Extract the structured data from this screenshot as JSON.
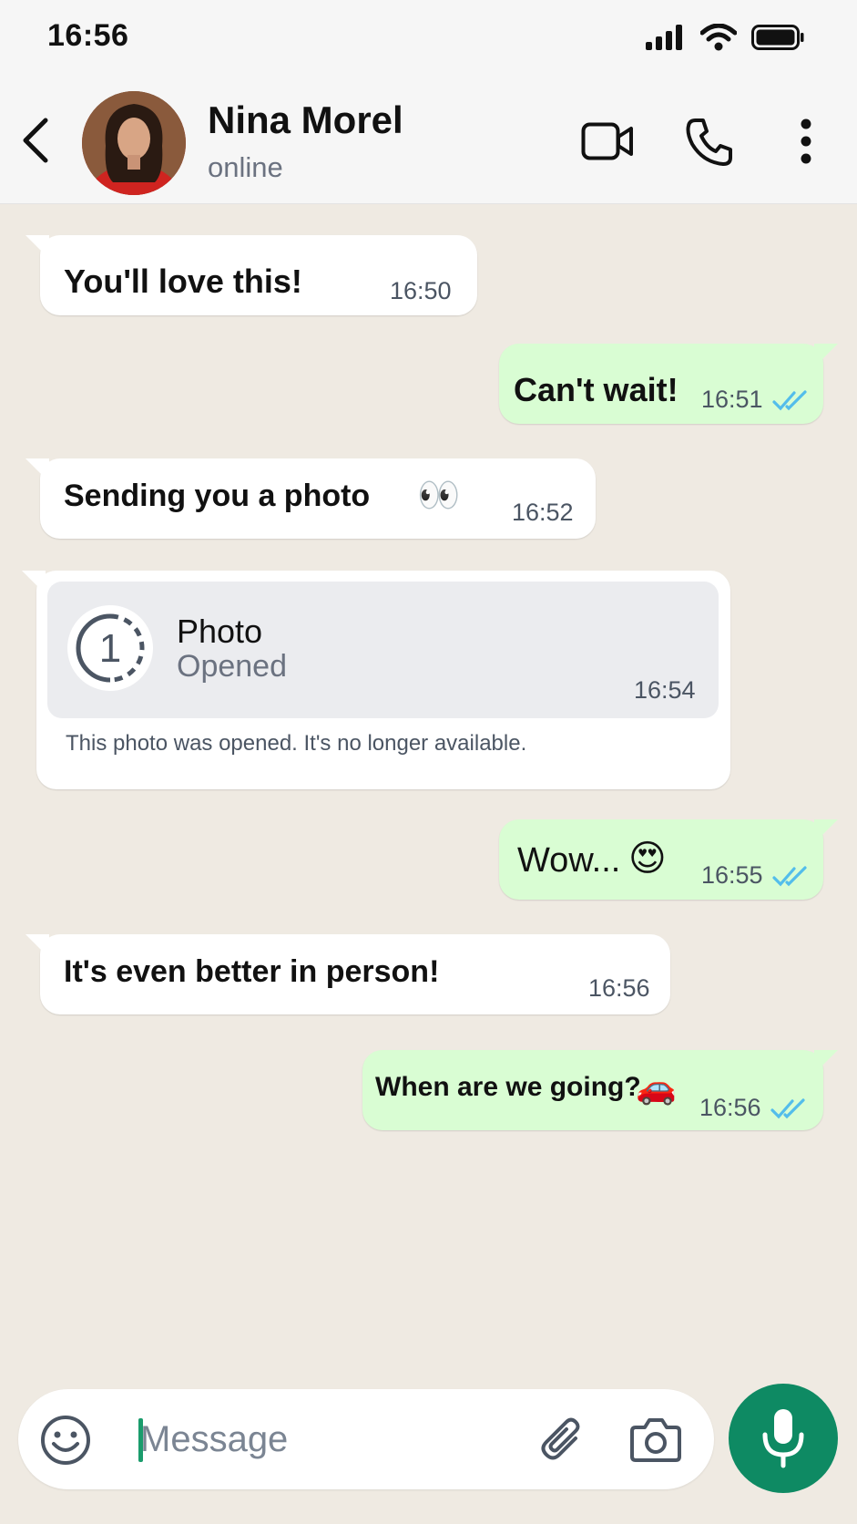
{
  "status_bar": {
    "time": "16:56"
  },
  "contact": {
    "name": "Nina Morel",
    "status": "online"
  },
  "messages": [
    {
      "direction": "in",
      "text": "You'll love this!",
      "time": "16:50"
    },
    {
      "direction": "out",
      "text": "Can't wait!",
      "time": "16:51",
      "read": true
    },
    {
      "direction": "in",
      "text": "Sending you a photo",
      "emoji": "👀",
      "time": "16:52"
    },
    {
      "direction": "in",
      "type": "view-once-photo",
      "title": "Photo",
      "state": "Opened",
      "counter": "1",
      "time": "16:54",
      "note": "This photo was opened. It's no longer available."
    },
    {
      "direction": "out",
      "text": "Wow...",
      "emoji": "😍",
      "time": "16:55",
      "read": true
    },
    {
      "direction": "in",
      "text": "It's even better in person!",
      "time": "16:56"
    },
    {
      "direction": "out",
      "text": "When are we going?",
      "emoji": "🚗",
      "time": "16:56",
      "read": true
    }
  ],
  "input": {
    "placeholder": "Message"
  },
  "colors": {
    "chat_background": "#efeae2",
    "incoming_bubble": "#ffffff",
    "outgoing_bubble": "#d9fdd3",
    "read_ticks": "#53bdeb",
    "accent": "#0e8a63"
  },
  "icons": [
    "back-arrow-icon",
    "video-camera-icon",
    "phone-icon",
    "more-vertical-icon",
    "emoji-icon",
    "attach-icon",
    "camera-icon",
    "mic-icon",
    "double-check-icon",
    "signal-icon",
    "wifi-icon",
    "battery-icon"
  ]
}
